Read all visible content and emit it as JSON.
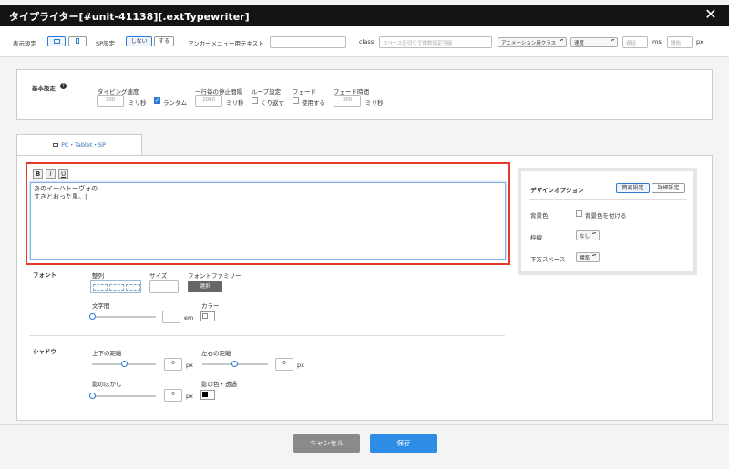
{
  "title": "タイプライター[#unit-41138][.extTypewriter]",
  "topbar": {
    "display_label": "表示設定",
    "sp_label": "SP設定",
    "sp_off": "しない",
    "sp_on": "する",
    "anchor_label": "アンカーメニュー用テキスト",
    "anchor_value": "",
    "class_label": "class",
    "class_placeholder": "スペース区切りで複数指定可能",
    "anim_class": "アニメーション用クラス",
    "speed_select": "速度",
    "delay_placeholder": "遅延",
    "ms_label": "ms",
    "start_placeholder": "開始",
    "px_label": "px"
  },
  "basic": {
    "heading": "基本設定",
    "help_icon": "?",
    "typing_speed_label": "タイピング速度",
    "typing_speed_value": "300",
    "ms_unit": "ミリ秒",
    "random_label": "ランダム",
    "line_pause_label": "一行毎の停止間隔",
    "line_pause_value": "2000",
    "loop_label": "ループ設定",
    "repeat_label": "くり返す",
    "fade_label": "フェード",
    "use_label": "使用する",
    "fade_time_label": "フェード時間",
    "fade_time_value": "300"
  },
  "tab": {
    "label": "PC・Tablet・SP"
  },
  "editor": {
    "bold": "B",
    "italic": "I",
    "underline": "U",
    "line1": "あのイーハトーヴォの",
    "line2": "すきとおった風。|"
  },
  "font": {
    "heading": "フォント",
    "align_label": "整列",
    "size_label": "サイズ",
    "size_value": "",
    "family_label": "フォントファミリー",
    "family_button": "選択",
    "spacing_label": "文字間",
    "spacing_value": "",
    "em_unit": "em",
    "color_label": "カラー"
  },
  "shadow": {
    "heading": "シャドウ",
    "vertical_label": "上下の距離",
    "vertical_value": "0",
    "horizontal_label": "左右の距離",
    "horizontal_value": "0",
    "blur_label": "影のぼかし",
    "blur_value": "0",
    "px_unit": "px",
    "color_label": "影の色・透過"
  },
  "design": {
    "heading": "デザインオプション",
    "simple_tab": "簡易設定",
    "detail_tab": "詳細設定",
    "bg_label": "背景色",
    "bg_check_label": "背景色を付ける",
    "border_label": "枠線",
    "border_value": "なし",
    "bottom_space_label": "下方スペース",
    "bottom_space_value": "標準"
  },
  "footer": {
    "cancel": "キャンセル",
    "save": "保存"
  },
  "colors": {
    "accent": "#2d7bd5",
    "highlight": "#e53b2c",
    "title_bg": "#141414",
    "save_bg": "#2d8de6",
    "cancel_bg": "#8a8a8a"
  }
}
